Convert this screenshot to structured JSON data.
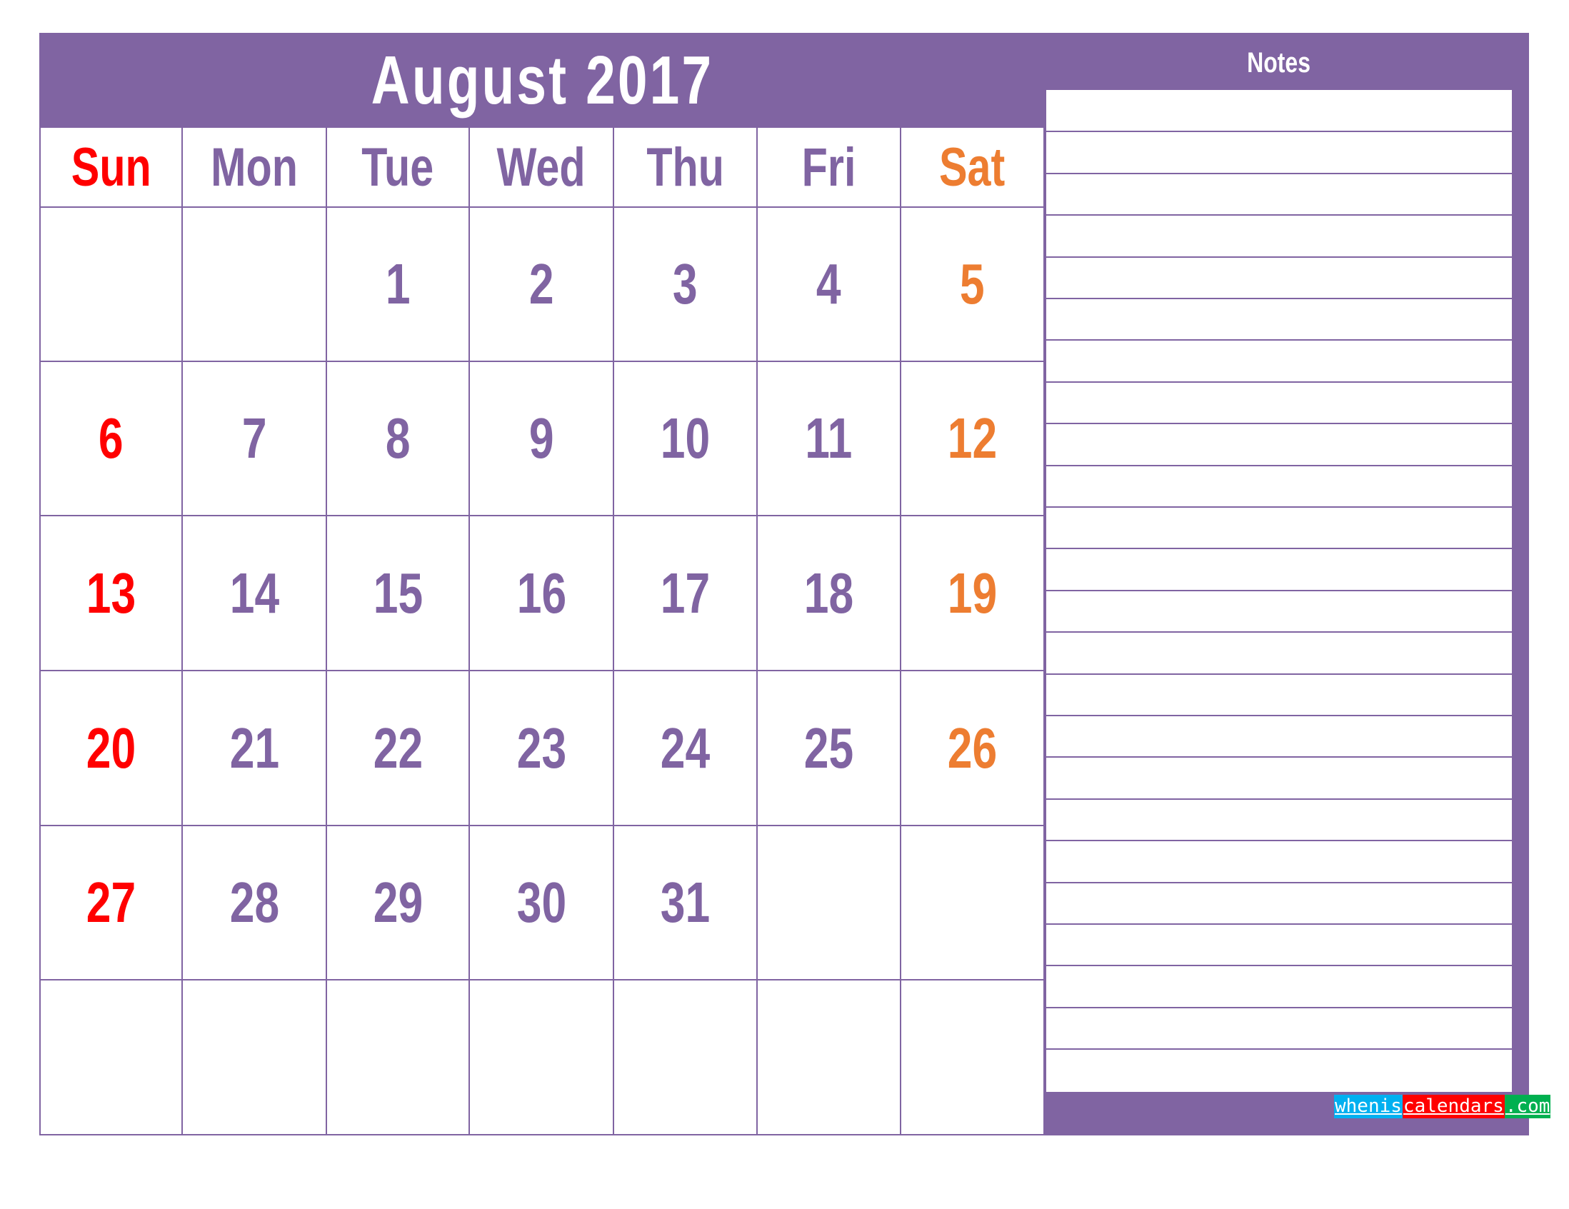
{
  "title": "August 2017",
  "notes_title": "Notes",
  "colors": {
    "frame": "#8064a2",
    "sunday": "#ff0000",
    "saturday": "#ed7d31",
    "weekday": "#8064a2"
  },
  "weekdays": [
    "Sun",
    "Mon",
    "Tue",
    "Wed",
    "Thu",
    "Fri",
    "Sat"
  ],
  "weeks": [
    [
      "",
      "",
      "1",
      "2",
      "3",
      "4",
      "5"
    ],
    [
      "6",
      "7",
      "8",
      "9",
      "10",
      "11",
      "12"
    ],
    [
      "13",
      "14",
      "15",
      "16",
      "17",
      "18",
      "19"
    ],
    [
      "20",
      "21",
      "22",
      "23",
      "24",
      "25",
      "26"
    ],
    [
      "27",
      "28",
      "29",
      "30",
      "31",
      "",
      ""
    ],
    [
      "",
      "",
      "",
      "",
      "",
      "",
      ""
    ]
  ],
  "logo": {
    "part1": "whenis",
    "part2": "calendars",
    "part3": ".com"
  }
}
